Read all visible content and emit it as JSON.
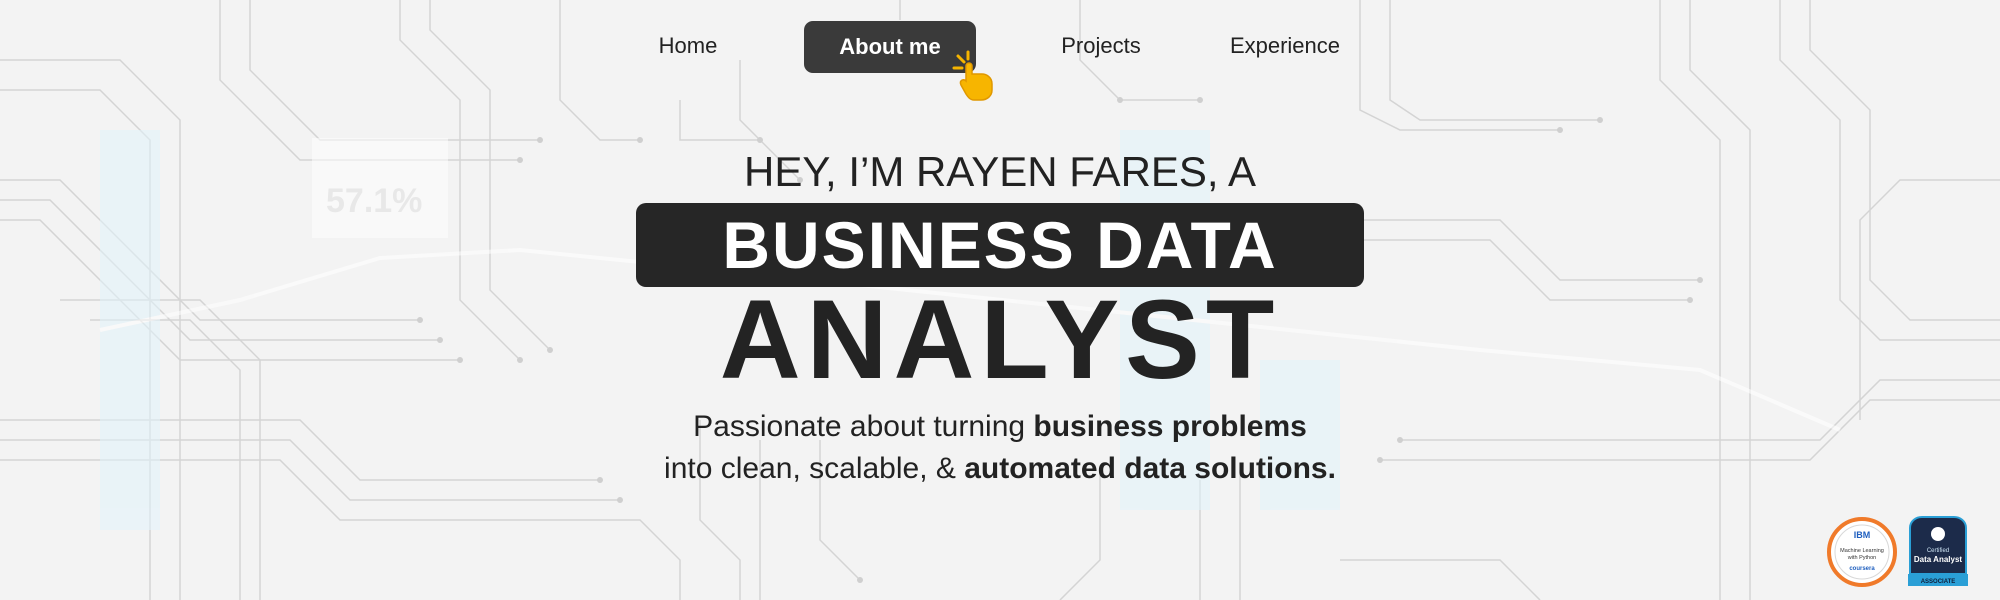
{
  "nav": {
    "items": [
      {
        "label": "Home"
      },
      {
        "label": "About me"
      },
      {
        "label": "Projects"
      },
      {
        "label": "Experience"
      }
    ],
    "active": "About me"
  },
  "hero": {
    "greeting": "HEY, I’M RAYEN FARES, A",
    "title_line1": "BUSINESS DATA",
    "title_line2": "ANALYST",
    "tagline_part1": "Passionate about turning ",
    "tagline_bold1": "business problems",
    "tagline_part2": "into clean, scalable, & ",
    "tagline_bold2": "automated data solutions."
  },
  "background": {
    "metric_value": "57.1%"
  },
  "badges": {
    "ibm": {
      "brand": "IBM",
      "line1": "Machine Learning",
      "line2": "with Python",
      "provider": "coursera"
    },
    "data_analyst": {
      "line1": "Certified",
      "line2": "Data Analyst",
      "level": "ASSOCIATE"
    }
  },
  "colors": {
    "background": "#f3f3f3",
    "dark": "#262626",
    "accent_cursor": "#f5b400",
    "badge_orange": "#f07a2a",
    "badge_navy": "#1c2b4a",
    "badge_blue": "#2a9fd6"
  }
}
